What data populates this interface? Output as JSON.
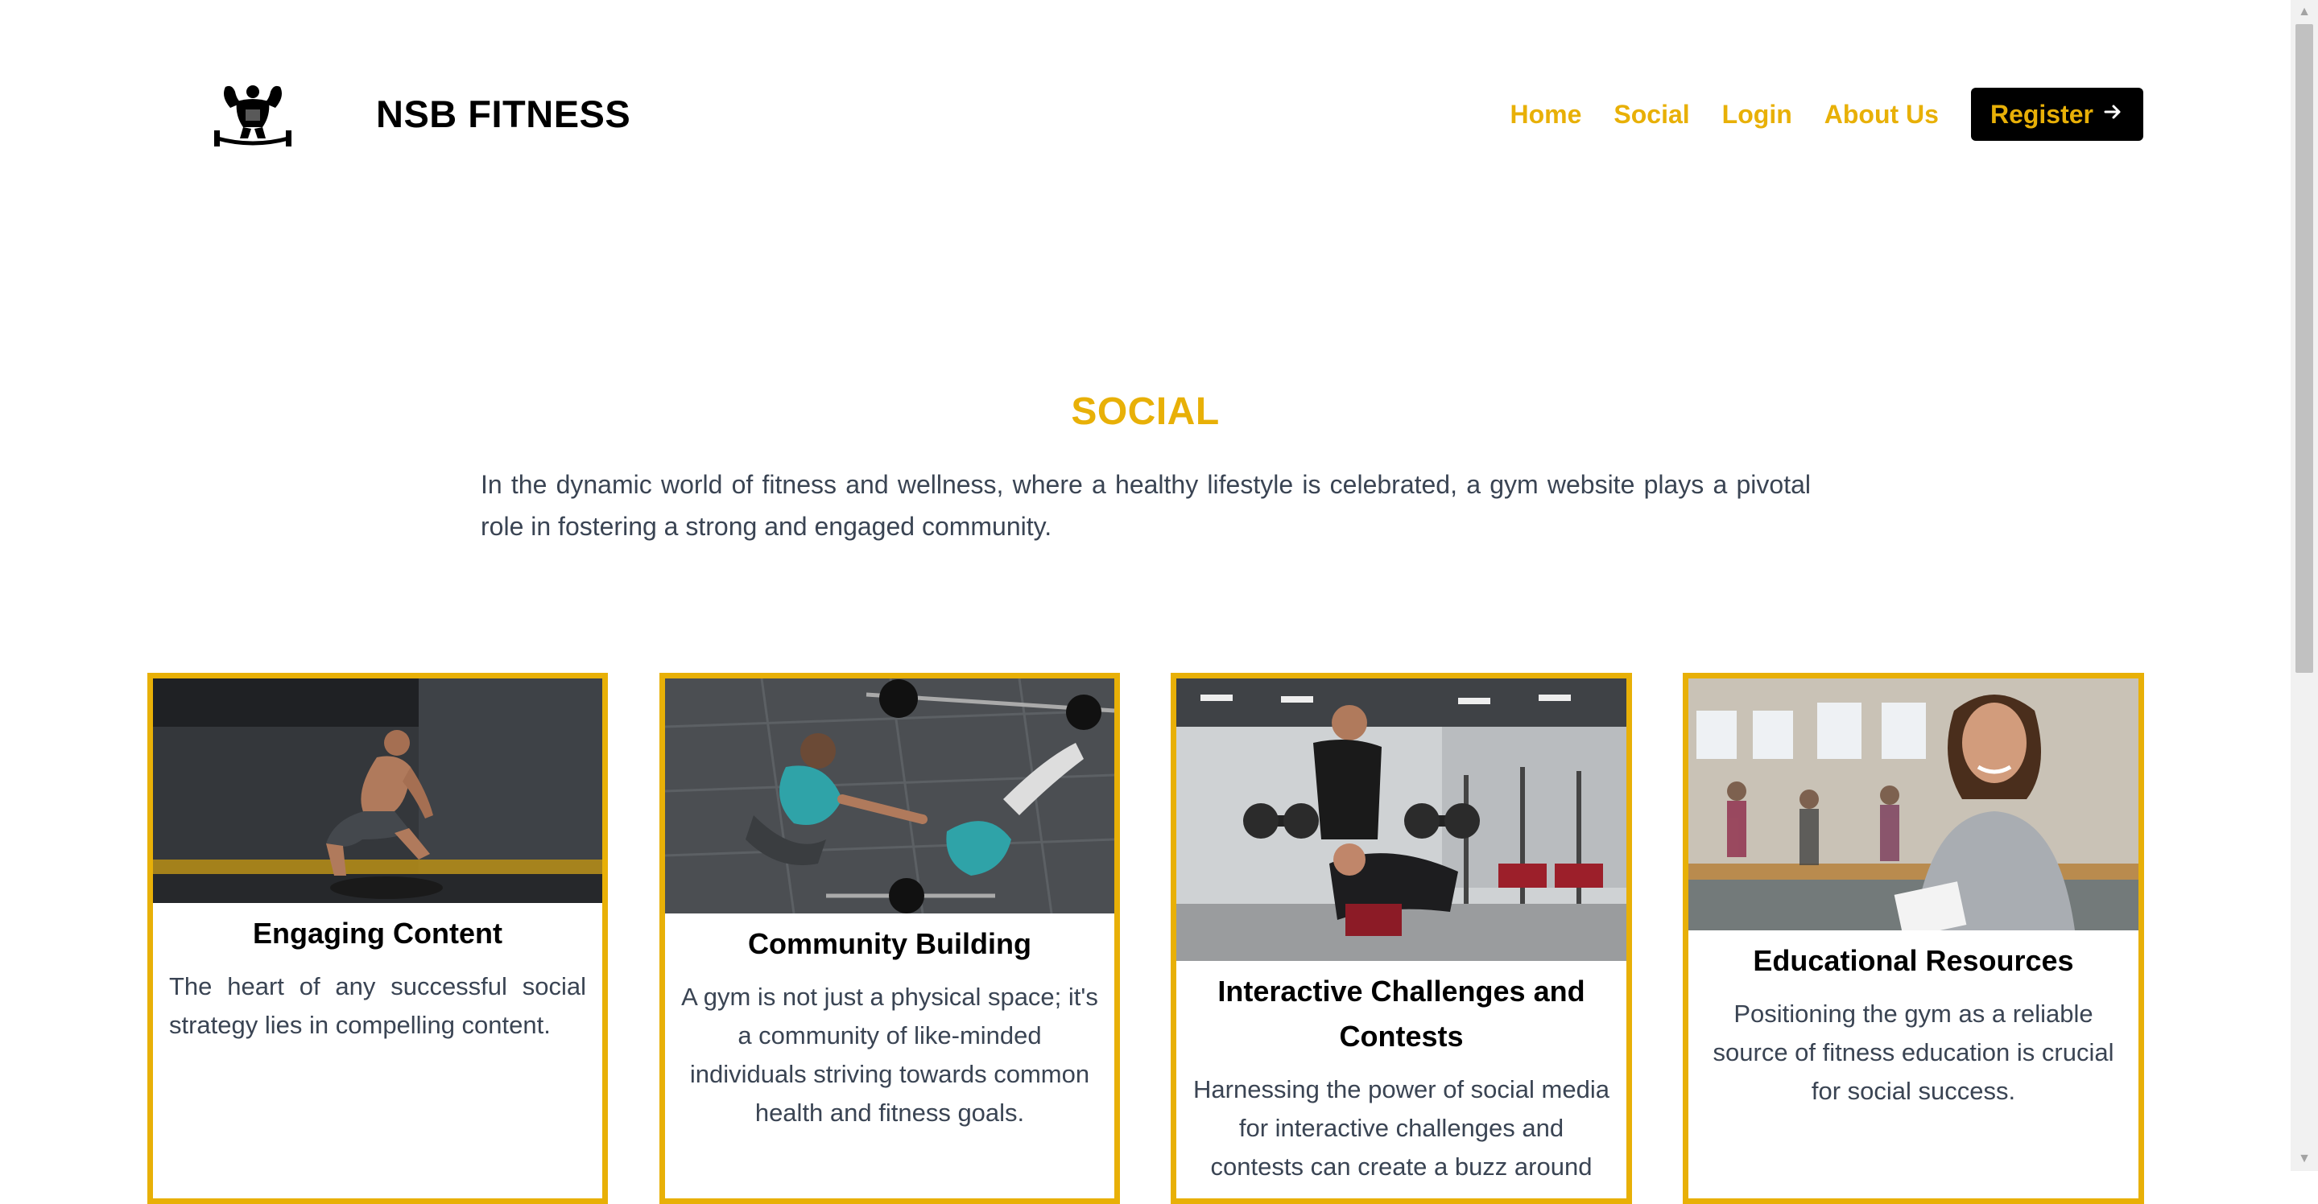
{
  "brand": {
    "name": "NSB FITNESS",
    "logo_icon": "bodybuilder-logo-icon"
  },
  "nav": {
    "home": "Home",
    "social": "Social",
    "login": "Login",
    "about": "About Us",
    "register": "Register",
    "register_icon": "arrow-right-icon"
  },
  "section": {
    "title": "SOCIAL",
    "intro": "In the dynamic world of fitness and wellness, where a healthy lifestyle is celebrated, a gym website plays a pivotal role in fostering a strong and engaged community."
  },
  "cards": [
    {
      "title": "Engaging Content",
      "text": "The heart of any successful social strategy lies in compelling content.",
      "image": "athlete-box-jump-photo"
    },
    {
      "title": "Community Building",
      "text": "A gym is not just a physical space; it's a community of like-minded individuals striving towards common health and fitness goals.",
      "image": "partners-fist-bump-photo"
    },
    {
      "title": "Interactive Challenges and Contests",
      "text": "Harnessing the power of social media for interactive challenges and contests can create a buzz around",
      "image": "trainer-spotting-dumbbell-press-photo"
    },
    {
      "title": "Educational Resources",
      "text": "Positioning the gym as a reliable source of fitness education is crucial for social success.",
      "image": "smiling-coach-with-clipboard-photo"
    }
  ],
  "colors": {
    "accent": "#e8b007",
    "text_body": "#3a4453",
    "button_bg": "#000000"
  }
}
